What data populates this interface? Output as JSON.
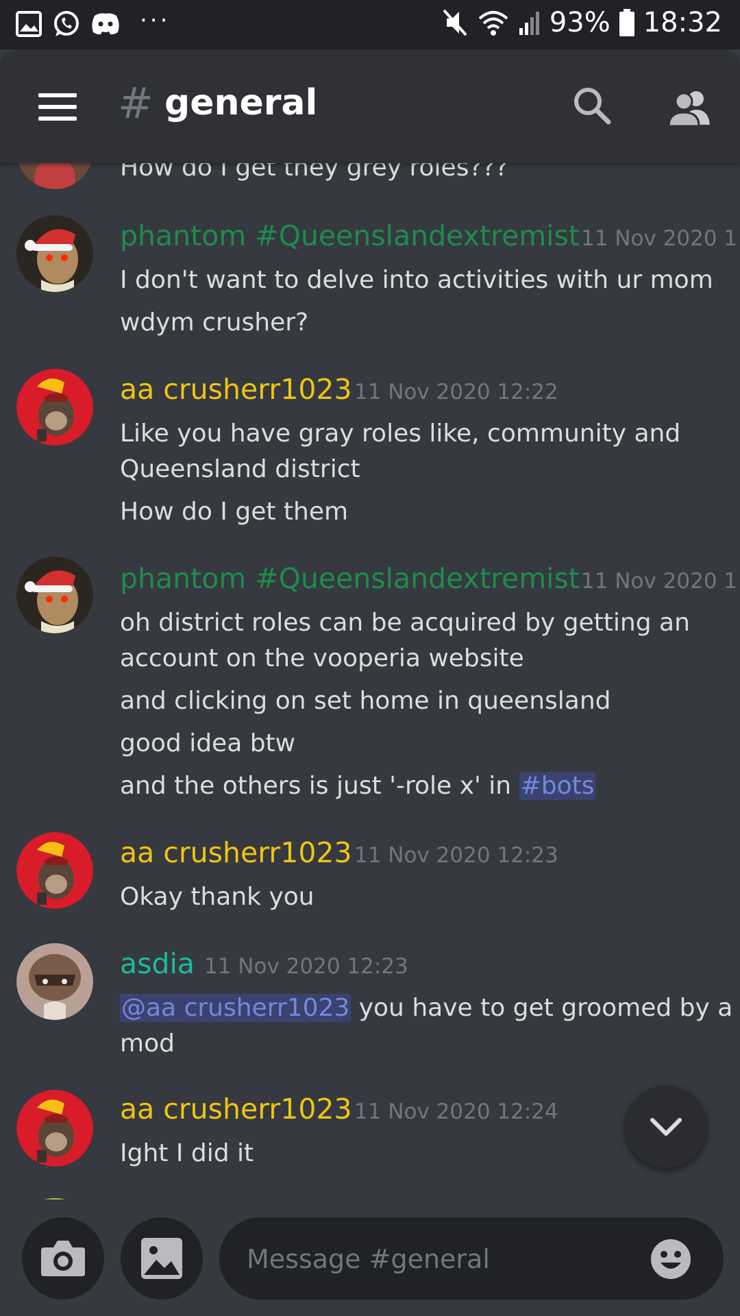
{
  "status_bar": {
    "left_icons": [
      "gallery-icon",
      "whatsapp-icon",
      "discord-icon"
    ],
    "more_indicator": "···",
    "battery_percent": "93%",
    "time": "18:32"
  },
  "header": {
    "hash": "#",
    "channel_name": "general",
    "background": "#2f3136"
  },
  "colors": {
    "phantom": "#1f8b4c",
    "crusher": "#f1c40f",
    "asdia": "#1abc9c",
    "mention": "#7289da",
    "background": "#36393f"
  },
  "messages": {
    "m0": {
      "line1": "How do I get they grey roles???"
    },
    "m1": {
      "username": "phantom #Queenslandextremist",
      "timestamp": "11 Nov 2020 1",
      "line1": "I don't want to delve into activities with ur mom",
      "line2": "wdym crusher?"
    },
    "m2": {
      "username": "aa crusherr1023",
      "timestamp": "11 Nov 2020 12:22",
      "line1": "Like you have gray roles like, community and",
      "line2": "Queensland district",
      "line3": "How do I get them"
    },
    "m3": {
      "username": "phantom #Queenslandextremist",
      "timestamp": "11 Nov 2020 1",
      "line1": "oh district roles can be acquired by getting an",
      "line2": "account on the vooperia website",
      "line3": "and clicking on set home in queensland",
      "line4": "good idea btw",
      "line5": "and the others is just '-role x' in ",
      "channel_link": "#bots"
    },
    "m4": {
      "username": "aa crusherr1023",
      "timestamp": "11 Nov 2020 12:23",
      "line1": "Okay thank you"
    },
    "m5": {
      "username": "asdia",
      "timestamp": "11 Nov 2020 12:23",
      "mention": "@aa crusherr1023",
      "line1_rest": " you have to get groomed by a",
      "line2": "mod"
    },
    "m6": {
      "username": "aa crusherr1023",
      "timestamp": "11 Nov 2020 12:24",
      "line1": "Ight I did it"
    }
  },
  "input": {
    "placeholder": "Message #general"
  }
}
